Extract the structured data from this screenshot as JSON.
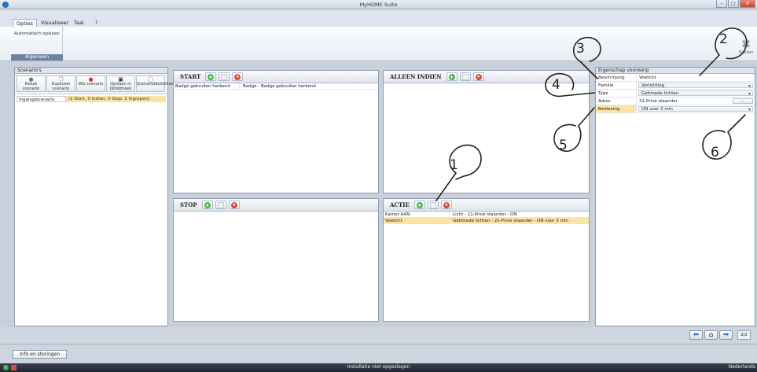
{
  "window": {
    "title": "MyHOME Suite"
  },
  "menu": {
    "tabs": [
      "Opties",
      "Visualiseer",
      "Taal",
      "?"
    ]
  },
  "ribbon": {
    "group_item": "Automatisch opslaan",
    "group_label": "Algemeen",
    "close_label": "Sluiten"
  },
  "scenarios": {
    "header": "Scenario's",
    "toolbar": [
      {
        "label": "Nieuw scenario",
        "icon": "add-icon"
      },
      {
        "label": "Dupliceer scenario",
        "icon": "duplicate-icon"
      },
      {
        "label": "Wis scenario",
        "icon": "delete-icon"
      },
      {
        "label": "Opslaan in bibliotheek",
        "icon": "save-icon"
      },
      {
        "label": "Scenariobibliotheek",
        "icon": "library-icon"
      }
    ],
    "rows": [
      {
        "name": "Ingangsscenario",
        "summary": "(1 Start, 0 Indien, 0 Stop, 2 Ingrepen)"
      }
    ]
  },
  "start": {
    "title": "START",
    "rows": [
      {
        "c1": "Badge gebruiker herkend",
        "c2": "Badge - Badge gebruiker herkend"
      }
    ]
  },
  "alleen_indien": {
    "title": "ALLEEN INDIEN",
    "rows": []
  },
  "stop": {
    "title": "STOP",
    "rows": []
  },
  "actie": {
    "title": "ACTIE",
    "rows": [
      {
        "c1": "Kamer AAN",
        "c2": "Licht - 11-Privé staander - ON"
      },
      {
        "c1": "Voelicht",
        "c2": "Getimede lichten - 21-Privé staander - ON voor 3 min"
      }
    ]
  },
  "properties": {
    "header": "Eigenschap voorwerp",
    "rows": [
      {
        "key": "Beschrijving",
        "value": "Voelicht"
      },
      {
        "key": "Familie",
        "value": "Verlichting"
      },
      {
        "key": "Type",
        "value": "Getimede lichten"
      },
      {
        "key": "Adres",
        "value": "21-Privé staander",
        "button": "..."
      },
      {
        "key": "Bediening",
        "value": "ON voor 3 min"
      }
    ]
  },
  "navigation": {
    "page": "2/2"
  },
  "bottom": {
    "tab": "Info en storingen"
  },
  "status": {
    "text": "Installatie niet opgeslagen",
    "language": "Nederlands"
  },
  "callouts": [
    "1",
    "2",
    "3",
    "4",
    "5",
    "6"
  ],
  "colors": {
    "selection": "#fbe3a6",
    "add": "#4cb24c",
    "delete": "#d8493a",
    "nav": "#2b76c8"
  }
}
